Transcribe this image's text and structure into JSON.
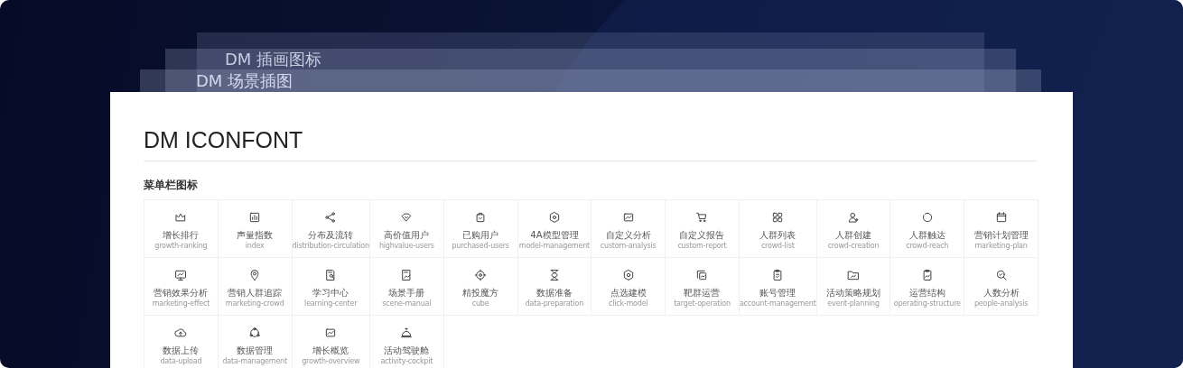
{
  "back_cards": [
    {
      "title": "DM 插画图标"
    },
    {
      "title": "DM 场景插图"
    }
  ],
  "page": {
    "title": "DM ICONFONT"
  },
  "section": {
    "title": "菜单栏图标"
  },
  "icons": [
    {
      "label": "增长排行",
      "code": "growth-ranking"
    },
    {
      "label": "声量指数",
      "code": "index"
    },
    {
      "label": "分布及流转",
      "code": "distribution-circulation"
    },
    {
      "label": "高价值用户",
      "code": "highvalue-users"
    },
    {
      "label": "已购用户",
      "code": "purchased-users"
    },
    {
      "label": "4A模型管理",
      "code": "model-management"
    },
    {
      "label": "自定义分析",
      "code": "custom-analysis"
    },
    {
      "label": "自定义报告",
      "code": "custom-report"
    },
    {
      "label": "人群列表",
      "code": "crowd-list"
    },
    {
      "label": "人群创建",
      "code": "crowd-creation"
    },
    {
      "label": "人群触达",
      "code": "crowd-reach"
    },
    {
      "label": "营销计划管理",
      "code": "marketing-plan"
    },
    {
      "label": "营销效果分析",
      "code": "marketing-effect"
    },
    {
      "label": "营销人群追踪",
      "code": "marketing-crowd"
    },
    {
      "label": "学习中心",
      "code": "learning-center"
    },
    {
      "label": "场景手册",
      "code": "scene-manual"
    },
    {
      "label": "精投魔方",
      "code": "cube"
    },
    {
      "label": "数据准备",
      "code": "data-preparation"
    },
    {
      "label": "点选建模",
      "code": "click-model"
    },
    {
      "label": "靶群运营",
      "code": "target-operation"
    },
    {
      "label": "账号管理",
      "code": "account-management"
    },
    {
      "label": "活动策略规划",
      "code": "event-planning"
    },
    {
      "label": "运营结构",
      "code": "operating-structure"
    },
    {
      "label": "人数分析",
      "code": "people-analysis"
    },
    {
      "label": "数据上传",
      "code": "data-upload"
    },
    {
      "label": "数据管理",
      "code": "data-management"
    },
    {
      "label": "增长概览",
      "code": "growth-overview"
    },
    {
      "label": "活动驾驶舱",
      "code": "activity-cockpit"
    }
  ]
}
